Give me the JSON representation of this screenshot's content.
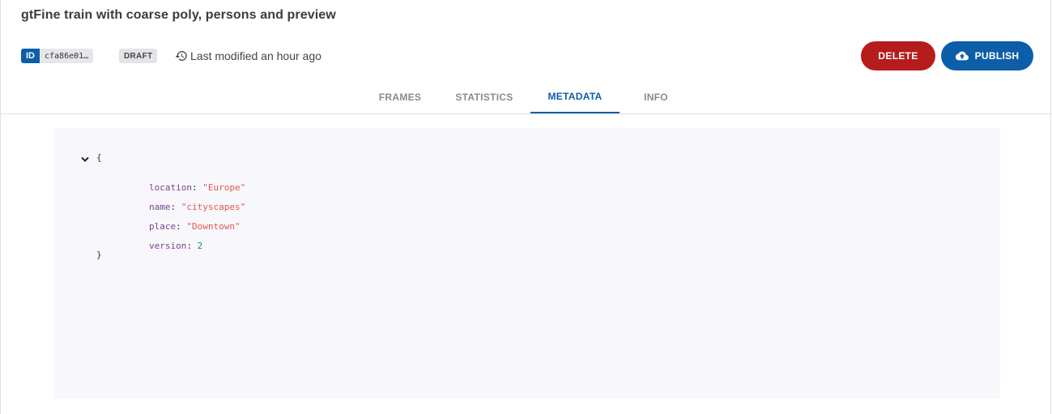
{
  "header": {
    "title": "gtFine train with coarse poly, persons and preview",
    "id_label": "ID",
    "id_value": "cfa86e01…",
    "status": "DRAFT",
    "modified": "Last modified an hour ago"
  },
  "actions": {
    "delete_label": "DELETE",
    "publish_label": "PUBLISH"
  },
  "tabs": [
    {
      "label": "FRAMES"
    },
    {
      "label": "STATISTICS"
    },
    {
      "label": "METADATA",
      "active": true
    },
    {
      "label": "INFO"
    }
  ],
  "metadata": {
    "open_brace": "{",
    "close_brace": "}",
    "entries": [
      {
        "key": "location",
        "value": "\"Europe\"",
        "type": "string"
      },
      {
        "key": "name",
        "value": "\"cityscapes\"",
        "type": "string"
      },
      {
        "key": "place",
        "value": "\"Downtown\"",
        "type": "string"
      },
      {
        "key": "version",
        "value": "2",
        "type": "number"
      }
    ]
  },
  "colors": {
    "primary": "#0d5ea8",
    "danger": "#b71c1c",
    "json_key": "#7b3f8f",
    "json_string": "#e55353",
    "json_number": "#0e8a8a"
  },
  "icons": {
    "history": "history-icon",
    "publish": "cloud-upload-icon",
    "collapse": "chevron-down-icon"
  }
}
